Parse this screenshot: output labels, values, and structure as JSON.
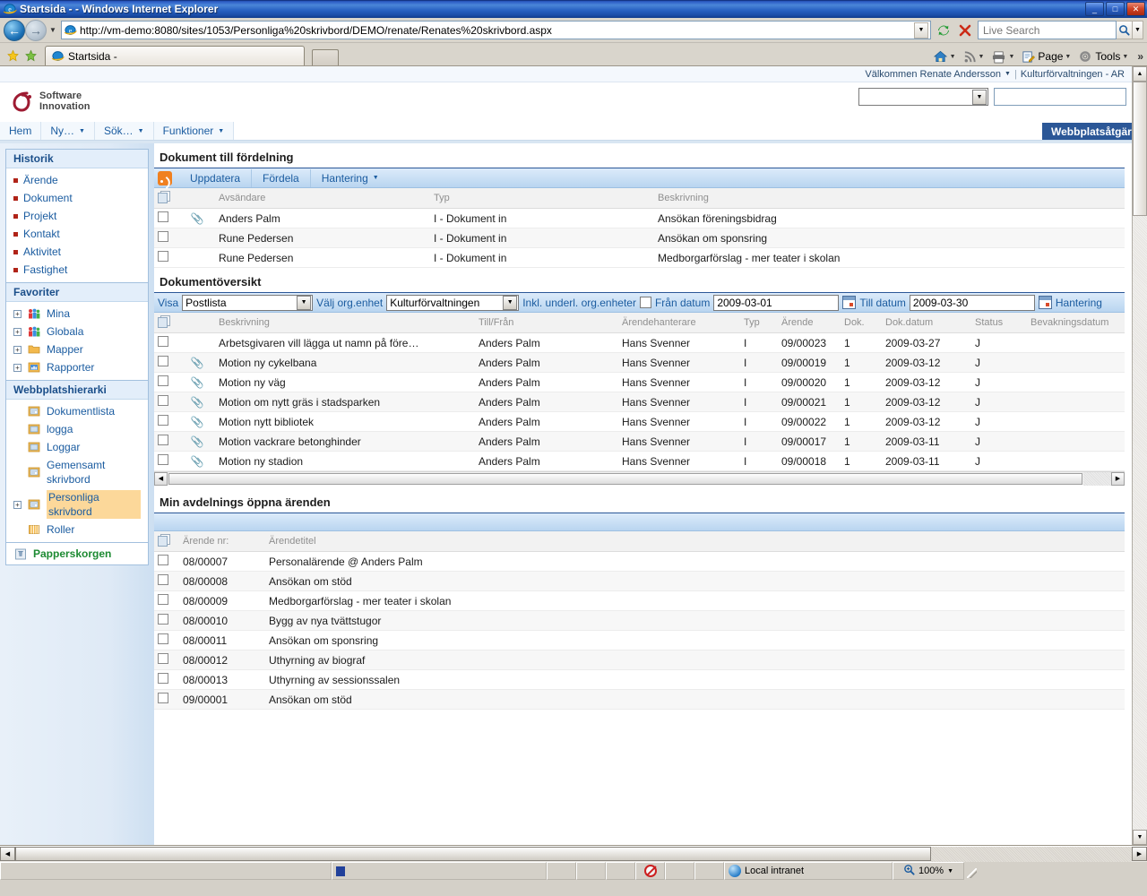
{
  "window": {
    "title": "Startsida -  - Windows Internet Explorer",
    "minimize_label": "_",
    "maximize_label": "□",
    "close_label": "✕"
  },
  "browser": {
    "back_label": "←",
    "forward_label": "→",
    "history_caret": "▼",
    "url": "http://vm-demo:8080/sites/1053/Personliga%20skrivbord/DEMO/renate/Renates%20skrivbord.aspx",
    "url_dropdown_caret": "▼",
    "refresh_icon": "↻",
    "stop_icon": "✕",
    "search_placeholder": "Live Search",
    "search_value": "",
    "search_go_icon": "🔍",
    "search_caret": "▼",
    "tab_label": "Startsida -",
    "new_tab_label": "",
    "favorites_star_icon": "★",
    "add_favorite_icon": "✣",
    "commands": [
      {
        "label": "",
        "name": "home-button",
        "icon": "🏠",
        "caret": "▼"
      },
      {
        "label": "",
        "name": "feeds-button",
        "icon": "◠",
        "caret": "▼"
      },
      {
        "label": "",
        "name": "print-button",
        "icon": "⎙",
        "caret": "▼"
      },
      {
        "label": "Page",
        "name": "page-button",
        "icon": "🗎",
        "caret": "▼"
      },
      {
        "label": "Tools",
        "name": "tools-button",
        "icon": "⚙",
        "caret": "▼"
      }
    ],
    "overflow_label": "»"
  },
  "portal": {
    "welcome_text": "Välkommen Renate Andersson",
    "welcome_caret": "▼",
    "separator": "|",
    "org_context": "Kulturförvaltningen - AR",
    "logo_line1": "Software",
    "logo_line2": "Innovation",
    "scope_value": "",
    "scope_caret": "▼",
    "query_value": "",
    "nav_items": [
      {
        "label": "Hem",
        "caret": ""
      },
      {
        "label": "Ny…",
        "caret": "▼"
      },
      {
        "label": "Sök…",
        "caret": "▼"
      },
      {
        "label": "Funktioner",
        "caret": "▼"
      }
    ],
    "site_actions": "Webbplatsåtgär"
  },
  "sidebar": {
    "sections": [
      {
        "title": "Historik",
        "name": "historik",
        "items": [
          {
            "label": "Ärende",
            "type": "bullet"
          },
          {
            "label": "Dokument",
            "type": "bullet"
          },
          {
            "label": "Projekt",
            "type": "bullet"
          },
          {
            "label": "Kontakt",
            "type": "bullet"
          },
          {
            "label": "Aktivitet",
            "type": "bullet"
          },
          {
            "label": "Fastighet",
            "type": "bullet"
          }
        ]
      },
      {
        "title": "Favoriter",
        "name": "favoriter",
        "items": [
          {
            "label": "Mina",
            "type": "tree",
            "expander": "+",
            "icon": "people-icon"
          },
          {
            "label": "Globala",
            "type": "tree",
            "expander": "+",
            "icon": "people-icon"
          },
          {
            "label": "Mapper",
            "type": "tree",
            "expander": "+",
            "icon": "folder-icon"
          },
          {
            "label": "Rapporter",
            "type": "tree",
            "expander": "+",
            "icon": "report-icon"
          }
        ]
      },
      {
        "title": "Webbplatshierarki",
        "name": "webbplatshierarki",
        "items": [
          {
            "label": "Dokumentlista",
            "type": "tree",
            "expander": "",
            "icon": "page-icon"
          },
          {
            "label": "logga",
            "type": "tree",
            "expander": "",
            "icon": "page-icon"
          },
          {
            "label": "Loggar",
            "type": "tree",
            "expander": "",
            "icon": "page-icon"
          },
          {
            "label": "Gemensamt skrivbord",
            "type": "tree",
            "expander": "",
            "icon": "page-icon"
          },
          {
            "label": "Personliga skrivbord",
            "type": "tree",
            "expander": "+",
            "icon": "page-icon",
            "selected": true
          },
          {
            "label": "Roller",
            "type": "tree",
            "expander": "",
            "icon": "grid-icon"
          }
        ]
      }
    ],
    "recycle_bin": {
      "label": "Papperskorgen",
      "icon": "recycle-bin-icon"
    }
  },
  "webparts": {
    "dokument_till_fordelning": {
      "title": "Dokument till fördelning",
      "toolbar": {
        "rss_icon": "rss-icon",
        "buttons": [
          {
            "label": "Uppdatera",
            "caret": ""
          },
          {
            "label": "Fördela",
            "caret": ""
          },
          {
            "label": "Hantering",
            "caret": "▼"
          }
        ]
      },
      "columns": [
        "",
        "",
        "Avsändare",
        "Typ",
        "Beskrivning"
      ],
      "rows": [
        {
          "attachment": true,
          "avsandare": "Anders Palm",
          "typ": "I - Dokument in",
          "beskrivning": "Ansökan föreningsbidrag"
        },
        {
          "attachment": false,
          "avsandare": "Rune Pedersen",
          "typ": "I - Dokument in",
          "beskrivning": "Ansökan om sponsring"
        },
        {
          "attachment": false,
          "avsandare": "Rune Pedersen",
          "typ": "I - Dokument in",
          "beskrivning": "Medborgarförslag - mer teater i skolan"
        }
      ]
    },
    "dokumentoversikt": {
      "title": "Dokumentöversikt",
      "filters": {
        "visa_label": "Visa",
        "visa_value": "Postlista",
        "org_label": "Välj org.enhet",
        "org_value": "Kulturförvaltningen",
        "inkl_label": "Inkl. underl. org.enheter",
        "inkl_checked": false,
        "fran_label": "Från datum",
        "fran_value": "2009-03-01",
        "till_label": "Till datum",
        "till_value": "2009-03-30",
        "hantering_label": "Hantering",
        "caret": "▼"
      },
      "columns": [
        "",
        "",
        "Beskrivning",
        "Till/Från",
        "Ärendehanterare",
        "Typ",
        "Ärende",
        "Dok.",
        "Dok.datum",
        "Status",
        "Bevakningsdatum"
      ],
      "rows": [
        {
          "attachment": false,
          "beskrivning": "Arbetsgivaren vill lägga ut namn på före…",
          "tillfran": "Anders Palm",
          "handlaggare": "Hans Svenner",
          "typ": "I",
          "arende": "09/00023",
          "dok": "1",
          "dokdatum": "2009-03-27",
          "status": "J",
          "bevakning": ""
        },
        {
          "attachment": true,
          "beskrivning": "Motion ny cykelbana",
          "tillfran": "Anders Palm",
          "handlaggare": "Hans Svenner",
          "typ": "I",
          "arende": "09/00019",
          "dok": "1",
          "dokdatum": "2009-03-12",
          "status": "J",
          "bevakning": ""
        },
        {
          "attachment": true,
          "beskrivning": "Motion ny väg",
          "tillfran": "Anders Palm",
          "handlaggare": "Hans Svenner",
          "typ": "I",
          "arende": "09/00020",
          "dok": "1",
          "dokdatum": "2009-03-12",
          "status": "J",
          "bevakning": ""
        },
        {
          "attachment": true,
          "beskrivning": "Motion om nytt gräs i stadsparken",
          "tillfran": "Anders Palm",
          "handlaggare": "Hans Svenner",
          "typ": "I",
          "arende": "09/00021",
          "dok": "1",
          "dokdatum": "2009-03-12",
          "status": "J",
          "bevakning": ""
        },
        {
          "attachment": true,
          "beskrivning": "Motion nytt bibliotek",
          "tillfran": "Anders Palm",
          "handlaggare": "Hans Svenner",
          "typ": "I",
          "arende": "09/00022",
          "dok": "1",
          "dokdatum": "2009-03-12",
          "status": "J",
          "bevakning": ""
        },
        {
          "attachment": true,
          "beskrivning": "Motion vackrare betonghinder",
          "tillfran": "Anders Palm",
          "handlaggare": "Hans Svenner",
          "typ": "I",
          "arende": "09/00017",
          "dok": "1",
          "dokdatum": "2009-03-11",
          "status": "J",
          "bevakning": ""
        },
        {
          "attachment": true,
          "beskrivning": "Motion ny stadion",
          "tillfran": "Anders Palm",
          "handlaggare": "Hans Svenner",
          "typ": "I",
          "arende": "09/00018",
          "dok": "1",
          "dokdatum": "2009-03-11",
          "status": "J",
          "bevakning": ""
        }
      ]
    },
    "min_avdelning": {
      "title": "Min avdelnings öppna ärenden",
      "columns": [
        "",
        "Ärende nr:",
        "Ärendetitel"
      ],
      "rows": [
        {
          "nr": "08/00007",
          "titel": "Personalärende @ Anders Palm"
        },
        {
          "nr": "08/00008",
          "titel": "Ansökan om stöd"
        },
        {
          "nr": "08/00009",
          "titel": "Medborgarförslag - mer teater i skolan"
        },
        {
          "nr": "08/00010",
          "titel": "Bygg av nya tvättstugor"
        },
        {
          "nr": "08/00011",
          "titel": "Ansökan om sponsring"
        },
        {
          "nr": "08/00012",
          "titel": "Uthyrning av biograf"
        },
        {
          "nr": "08/00013",
          "titel": "Uthyrning av sessionssalen"
        },
        {
          "nr": "09/00001",
          "titel": "Ansökan om stöd"
        }
      ]
    }
  },
  "statusbar": {
    "message": "",
    "zone_label": "Local intranet",
    "zoom_label": "100%",
    "zoom_caret": "▼",
    "zoom_icon": "🔍"
  },
  "colors": {
    "accent_blue": "#2b5797",
    "link_blue": "#15489b",
    "rss_orange": "#f08020",
    "selected_highlight": "#fcd89a",
    "trash_green": "#1d8a32"
  }
}
